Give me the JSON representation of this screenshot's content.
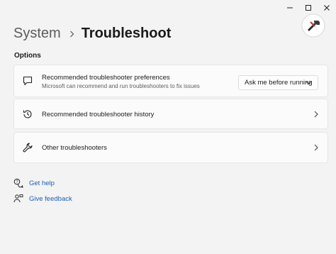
{
  "breadcrumb": {
    "parent": "System",
    "current": "Troubleshoot"
  },
  "section": {
    "label": "Options"
  },
  "cards": {
    "preferences": {
      "title": "Recommended troubleshooter preferences",
      "subtitle": "Microsoft can recommend and run troubleshooters to fix issues",
      "dropdown_value": "Ask me before running",
      "icon": "chat-bubble-icon"
    },
    "history": {
      "title": "Recommended troubleshooter history",
      "icon": "history-icon"
    },
    "other": {
      "title": "Other troubleshooters",
      "icon": "wrench-icon"
    }
  },
  "links": {
    "help": {
      "label": "Get help",
      "icon": "help-icon"
    },
    "feedback": {
      "label": "Give feedback",
      "icon": "feedback-icon"
    }
  },
  "colors": {
    "background": "#f3f3f3",
    "card": "#fbfbfb",
    "link": "#1a5fb4"
  }
}
